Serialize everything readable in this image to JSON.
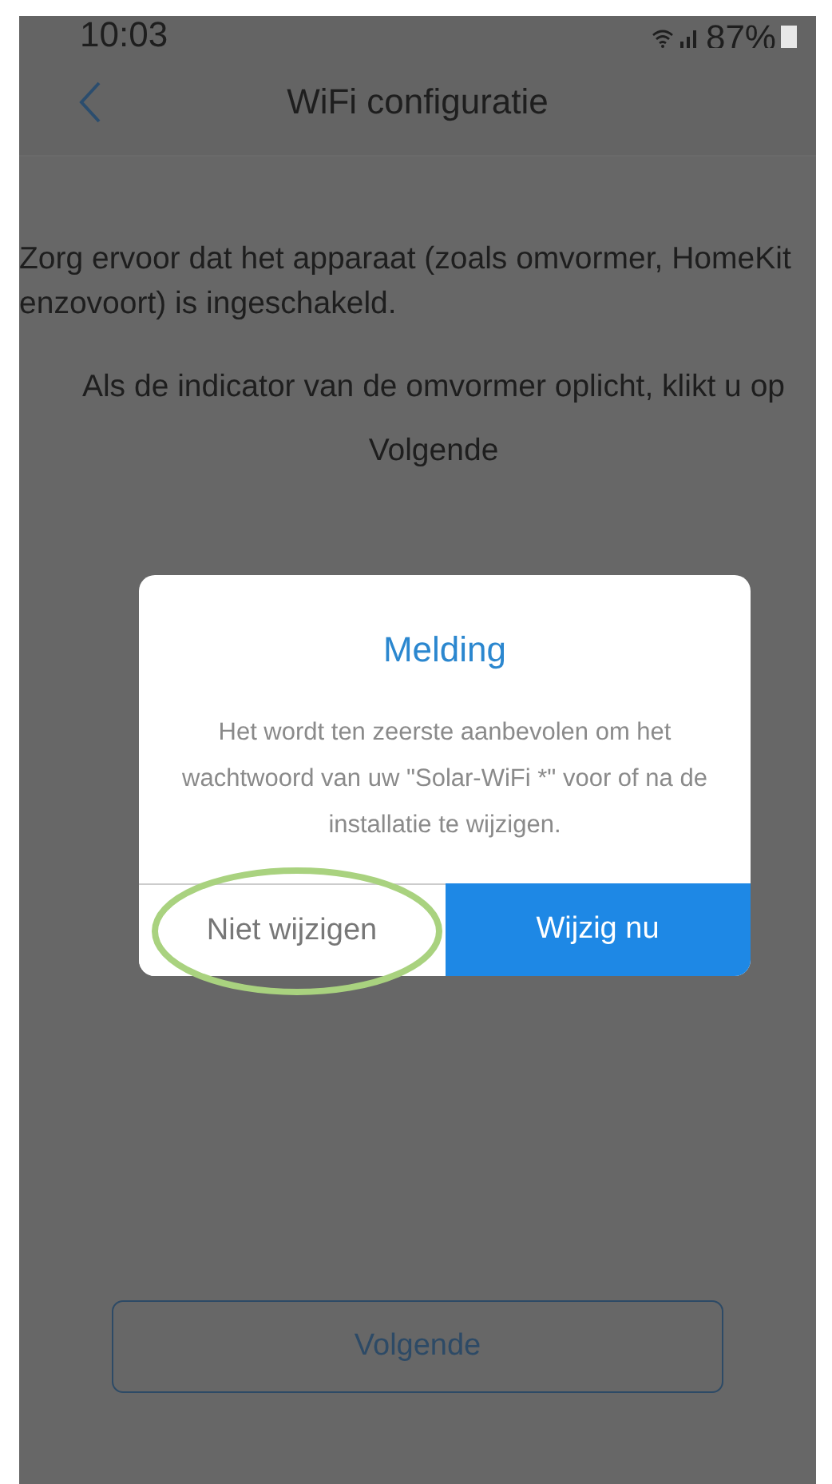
{
  "status_bar": {
    "time": "10:03",
    "battery": "87%"
  },
  "header": {
    "title": "WiFi configuratie"
  },
  "intro": "Zorg ervoor dat het apparaat (zoals omvormer, HomeKit enzovoort) is ingeschakeld.",
  "instruction": "Als de indicator van de omvormer oplicht, klikt u op Volgende",
  "dialog": {
    "title": "Melding",
    "message": "Het wordt ten zeerste aanbevolen om het wachtwoord van uw \"Solar-WiFi *\" voor of na de installatie te wijzigen.",
    "buttons": [
      {
        "label": "Niet wijzigen",
        "kind": "secondary"
      },
      {
        "label": "Wijzig nu",
        "kind": "primary"
      }
    ]
  },
  "next_button": "Volgende"
}
